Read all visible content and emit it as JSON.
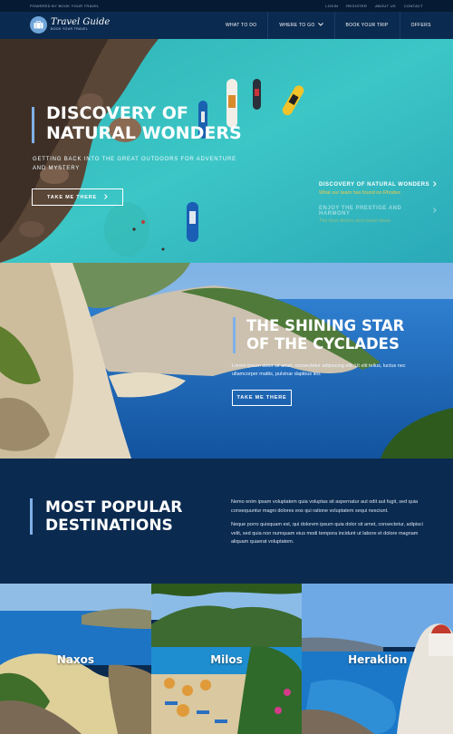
{
  "topbar": {
    "tagline": "POWERED BY BOOK YOUR TRAVEL",
    "links": [
      "LOGIN",
      "REGISTER",
      "ABOUT US",
      "CONTACT"
    ]
  },
  "header": {
    "logo_name": "Travel Guide",
    "logo_sub": "BOOK YOUR TRAVEL",
    "nav": [
      {
        "label": "WHAT TO DO"
      },
      {
        "label": "WHERE TO GO",
        "dropdown": true
      },
      {
        "label": "BOOK YOUR TRIP"
      },
      {
        "label": "OFFERS"
      }
    ]
  },
  "hero1": {
    "title_line1": "DISCOVERY OF",
    "title_line2": "NATURAL WONDERS",
    "subtitle": "GETTING BACK INTO THE GREAT OUTDOORS FOR ADVENTURE AND MYSTERY",
    "cta": "TAKE ME THERE",
    "slides": [
      {
        "title": "DISCOVERY OF NATURAL WONDERS",
        "subtitle": "What our team has found on Rhodes",
        "active": true
      },
      {
        "title": "ENJOY THE PRESTIGE AND HARMONY",
        "subtitle": "The best dishes and travel ideas",
        "active": false
      }
    ]
  },
  "hero2": {
    "title_line1": "THE SHINING STAR",
    "title_line2": "OF THE CYCLADES",
    "text": "Lorem ipsum dolor sit amet, consectetur adipiscing elit. Ut elit tellus, luctus nec ullamcorper mattis, pulvinar dapibus leo.",
    "cta": "TAKE ME THERE"
  },
  "popular": {
    "title_line1": "MOST POPULAR",
    "title_line2": "DESTINATIONS",
    "paragraph1": "Nemo enim ipsam voluptatem quia voluptas sit aspernatur aut odit aut fugit, sed quia consequuntur magni dolores eos qui ratione voluptatem sequi nesciunt.",
    "paragraph2": "Neque porro quisquam est, qui dolorem ipsum quia dolor sit amet, consectetur, adipisci velit, sed quia non numquam eius modi tempora incidunt ut labore et dolore magnam aliquam quaerat voluptatem."
  },
  "destinations": [
    {
      "name": "Naxos"
    },
    {
      "name": "Milos"
    },
    {
      "name": "Heraklion"
    }
  ],
  "colors": {
    "navy": "#0b2a4f",
    "topbar": "#071a33",
    "accent_bar": "#7fb0e8",
    "slide_subtitle": "#f0c94a",
    "sea_turquoise": "#36bcc2"
  }
}
